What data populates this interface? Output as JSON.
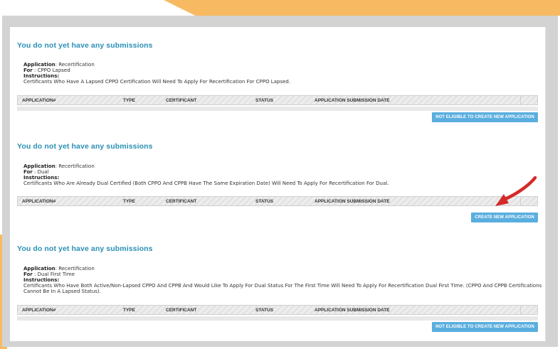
{
  "columns": [
    "APPLICATION#",
    "TYPE",
    "CERTIFICANT",
    "STATUS",
    "APPLICATION SUBMISSION DATE"
  ],
  "sections": [
    {
      "heading": "You do not yet have any submissions",
      "application_label": "Application",
      "application_value": ": Recertification",
      "for_label": "For",
      "for_value": " : CPPO Lapsed",
      "instructions_label": "Instructions:",
      "instructions_text": "Certificants Who Have A Lapsed CPPO Certification Will Need To Apply For Recertification For CPPO Lapsed.",
      "button_label": "NOT ELIGIBLE TO CREATE NEW APPLICATION"
    },
    {
      "heading": "You do not yet have any submissions",
      "application_label": "Application",
      "application_value": ": Recertification",
      "for_label": "For",
      "for_value": " : Dual",
      "instructions_label": "Instructions:",
      "instructions_text": "Certificants Who Are Already Dual Certified (Both CPPO And CPPB Have The Same Expiration Date) Will Need To Apply For Recertification For Dual.",
      "button_label": "CREATE NEW APPLICATION"
    },
    {
      "heading": "You do not yet have any submissions",
      "application_label": "Application",
      "application_value": ": Recertification",
      "for_label": "For",
      "for_value": " : Dual First Time",
      "instructions_label": "Instructions:",
      "instructions_text": "Certificants Who Have Both Active/Non-Lapsed CPPO And CPPB And Would Like To Apply For Dual Status For The First Time Will Need To Apply For Recertification Dual First Time. (CPPO And CPPB Certifications Cannot Be In A Lapsed Status).",
      "button_label": "NOT ELIGIBLE TO CREATE NEW APPLICATION"
    }
  ],
  "colors": {
    "heading": "#2a8fb5",
    "button": "#5aaedf",
    "accent": "#f7ba63",
    "arrow": "#d42a2a"
  }
}
